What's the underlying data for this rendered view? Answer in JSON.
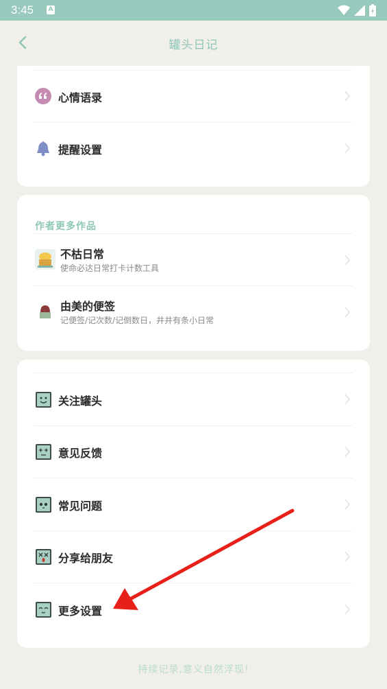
{
  "status_bar": {
    "time": "3:45",
    "sim_label": "A"
  },
  "header": {
    "title": "罐头日记"
  },
  "menu_top": [
    {
      "label": "心情语录",
      "icon": "quote-icon"
    },
    {
      "label": "提醒设置",
      "icon": "bell-icon"
    }
  ],
  "author_section": {
    "title": "作者更多作品",
    "apps": [
      {
        "name": "不枯日常",
        "desc": "使命必达日常打卡计数工具",
        "icon": "bukurichang-app-icon"
      },
      {
        "name": "由美的便签",
        "desc": "记便签/记次数/记倒数日，井井有条小日常",
        "icon": "youmei-app-icon"
      }
    ]
  },
  "menu_bottom": [
    {
      "label": "关注罐头",
      "icon": "follow-face-icon"
    },
    {
      "label": "意见反馈",
      "icon": "feedback-face-icon"
    },
    {
      "label": "常见问题",
      "icon": "faq-face-icon"
    },
    {
      "label": "分享给朋友",
      "icon": "share-face-icon"
    },
    {
      "label": "更多设置",
      "icon": "settings-face-icon"
    }
  ],
  "footer": {
    "slogan": "持续记录,意义自然浮现!"
  },
  "colors": {
    "accent": "#8fc7b8",
    "status_bar": "#97cabd",
    "annotation_arrow": "#e8201a"
  }
}
